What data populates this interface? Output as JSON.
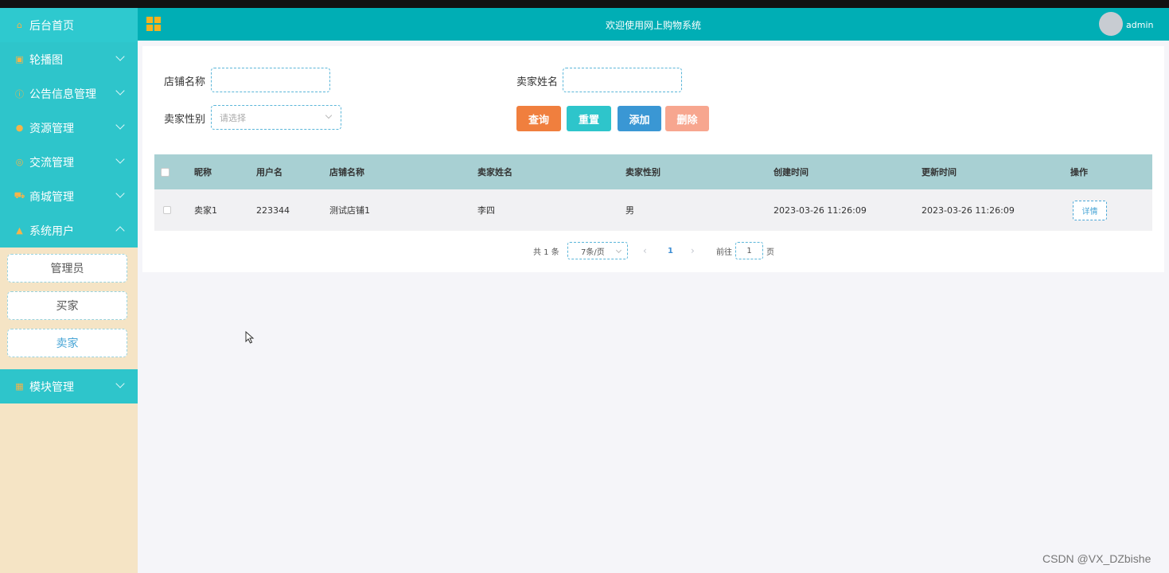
{
  "sidebar": {
    "items": [
      {
        "label": "后台首页",
        "icon": "home-icon"
      },
      {
        "label": "轮播图",
        "icon": "image-icon"
      },
      {
        "label": "公告信息管理",
        "icon": "info-icon"
      },
      {
        "label": "资源管理",
        "icon": "location-icon"
      },
      {
        "label": "交流管理",
        "icon": "settings-icon"
      },
      {
        "label": "商城管理",
        "icon": "cart-icon"
      },
      {
        "label": "系统用户",
        "icon": "user-icon"
      },
      {
        "label": "模块管理",
        "icon": "grid-icon"
      }
    ],
    "subitems": [
      "管理员",
      "买家",
      "卖家"
    ],
    "active_subitem": "卖家"
  },
  "header": {
    "title": "欢迎使用网上购物系统",
    "username": "admin"
  },
  "search": {
    "shop_name_label": "店铺名称",
    "shop_name_value": "",
    "seller_name_label": "卖家姓名",
    "seller_name_value": "",
    "seller_gender_label": "卖家性别",
    "seller_gender_placeholder": "请选择"
  },
  "buttons": {
    "query": "查询",
    "reset": "重置",
    "add": "添加",
    "delete": "删除"
  },
  "table": {
    "headers": [
      "昵称",
      "用户名",
      "店铺名称",
      "卖家姓名",
      "卖家性别",
      "创建时间",
      "更新时间",
      "操作"
    ],
    "rows": [
      {
        "nickname": "卖家1",
        "username": "223344",
        "shop_name": "测试店铺1",
        "seller_name": "李四",
        "gender": "男",
        "created": "2023-03-26 11:26:09",
        "updated": "2023-03-26 11:26:09",
        "action": "详情"
      }
    ]
  },
  "pagination": {
    "total": "共 1 条",
    "page_size": "7条/页",
    "current_page": "1",
    "goto_label": "前往",
    "goto_value": "1",
    "page_suffix": "页"
  },
  "watermark": "CSDN @VX_DZbishe",
  "colors": {
    "header": "#00aeb5",
    "sidebar_menu": "#2ec5cb",
    "sidebar_bg": "#f5e4c5",
    "query_btn": "#f07f3e",
    "reset_btn": "#2ec5cb",
    "add_btn": "#3a97d4",
    "delete_btn": "#f7a68f",
    "table_header": "#a8d0d3"
  }
}
